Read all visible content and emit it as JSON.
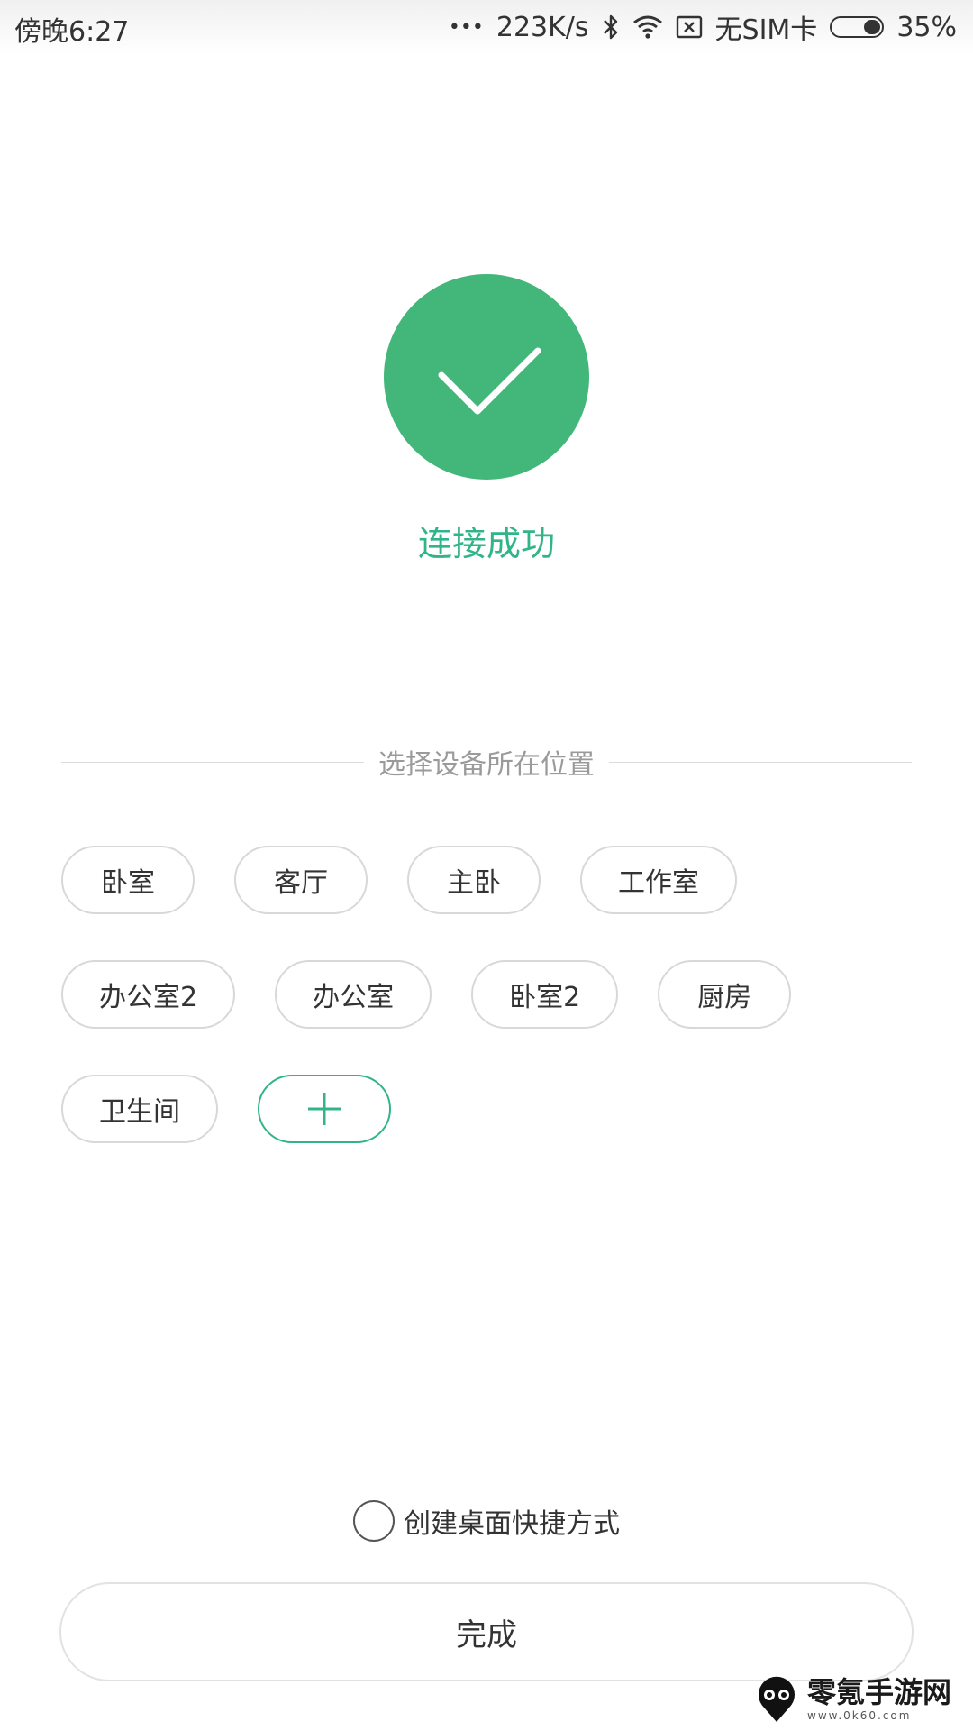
{
  "status_bar": {
    "time": "傍晚6:27",
    "more": "•••",
    "net_speed": "223K/s",
    "sim": "无SIM卡",
    "battery": "35%",
    "battery_level": 0.35
  },
  "success": {
    "message": "连接成功",
    "color": "#43b77a",
    "text_color": "#31b489"
  },
  "location": {
    "title": "选择设备所在位置",
    "rooms": [
      [
        "卧室",
        "客厅",
        "主卧",
        "工作室"
      ],
      [
        "办公室2",
        "办公室",
        "卧室2",
        "厨房"
      ],
      [
        "卫生间"
      ]
    ]
  },
  "shortcut": {
    "label": "创建桌面快捷方式"
  },
  "done_button": {
    "label": "完成"
  },
  "watermark": {
    "name": "零氪手游网",
    "url": "www.0k60.com"
  }
}
